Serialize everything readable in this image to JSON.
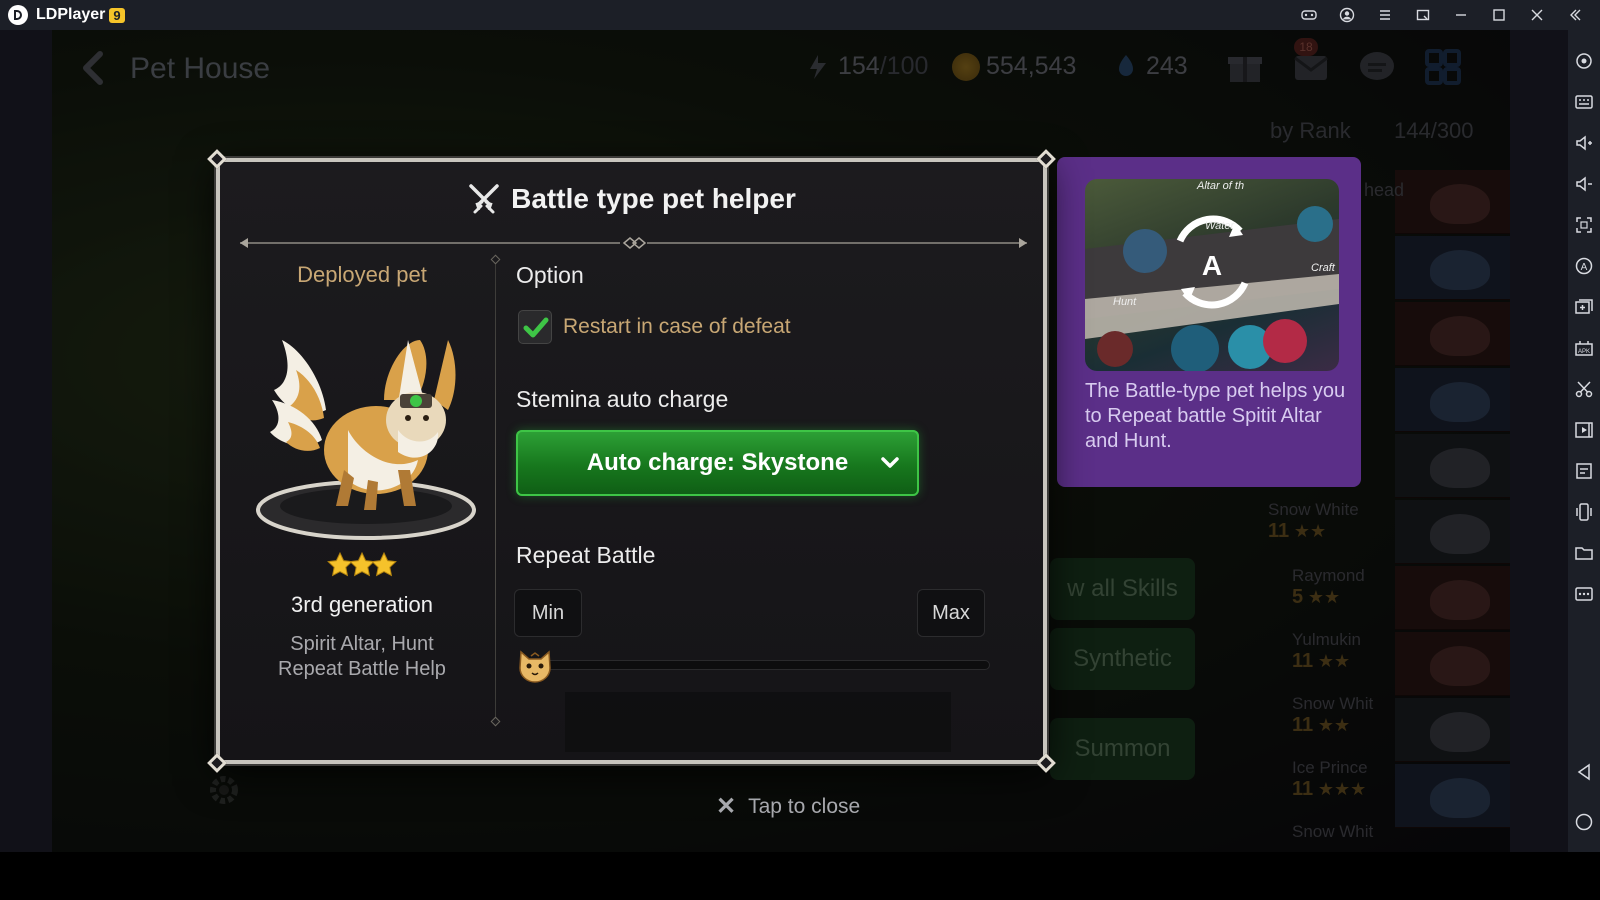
{
  "window": {
    "app_title": "LDPlayer",
    "version_badge": "9"
  },
  "game": {
    "screen_title": "Pet House",
    "stats": {
      "stamina_value": "154",
      "stamina_max": "/100",
      "gold": "554,543",
      "skystone": "243",
      "mail_badge": "18"
    },
    "sort_label": "by Rank",
    "pet_capacity": "144/300",
    "background_buttons": {
      "view_all_skills": "w all Skills",
      "synthetic": "Synthetic",
      "summon": "Summon"
    },
    "roster": [
      {
        "name": "Snow White",
        "level": "11",
        "stars": "★★"
      },
      {
        "name": "Raymond",
        "level": "5",
        "stars": "★★"
      },
      {
        "name": "Yulmukin",
        "level": "11",
        "stars": "★★"
      },
      {
        "name": "Snow Whit",
        "level": "11",
        "stars": "★★"
      },
      {
        "name": "Ice Prince",
        "level": "11",
        "stars": "★★★"
      },
      {
        "name": "Snow Whit",
        "level": "",
        "stars": ""
      }
    ],
    "roster_header_fragment": "head",
    "tap_to_close": "Tap to close"
  },
  "modal": {
    "title": "Battle type pet helper",
    "deployed_pet_label": "Deployed pet",
    "pet_stars": 3,
    "generation": "3rd generation",
    "pet_description_line1": "Spirit Altar, Hunt",
    "pet_description_line2": "Repeat Battle Help",
    "option_label": "Option",
    "restart_checkbox": {
      "label": "Restart in case of defeat",
      "checked": true
    },
    "stamina_label": "Stemina auto charge",
    "auto_charge_value": "Auto charge: Skystone",
    "repeat_battle_label": "Repeat Battle",
    "min_label": "Min",
    "max_label": "Max",
    "repeat_slider_fraction": 0
  },
  "info_panel": {
    "text": "The Battle-type pet helps you to Repeat battle Spitit Altar and Hunt.",
    "thumb_labels": {
      "top": "Altar of th",
      "middle": "Water",
      "left": "Hunt",
      "right": "Craft",
      "badge": "A"
    }
  },
  "colors": {
    "accent_green": "#2ea237",
    "gold_text": "#c8a774",
    "panel_purple": "#5b2f88"
  },
  "icons": [
    "ldplayer-logo",
    "gamepad-icon",
    "account-icon",
    "menu-icon",
    "window-icon",
    "minimize-icon",
    "maximize-icon",
    "close-icon",
    "collapse-icon",
    "back-arrow-icon",
    "stamina-icon",
    "gold-coin-icon",
    "skystone-icon",
    "gift-icon",
    "mail-icon",
    "chat-icon",
    "grid-icon",
    "crossed-swords-icon",
    "checkmark-icon",
    "chevron-down-icon",
    "cat-face-icon",
    "gear-icon",
    "star-icon"
  ]
}
